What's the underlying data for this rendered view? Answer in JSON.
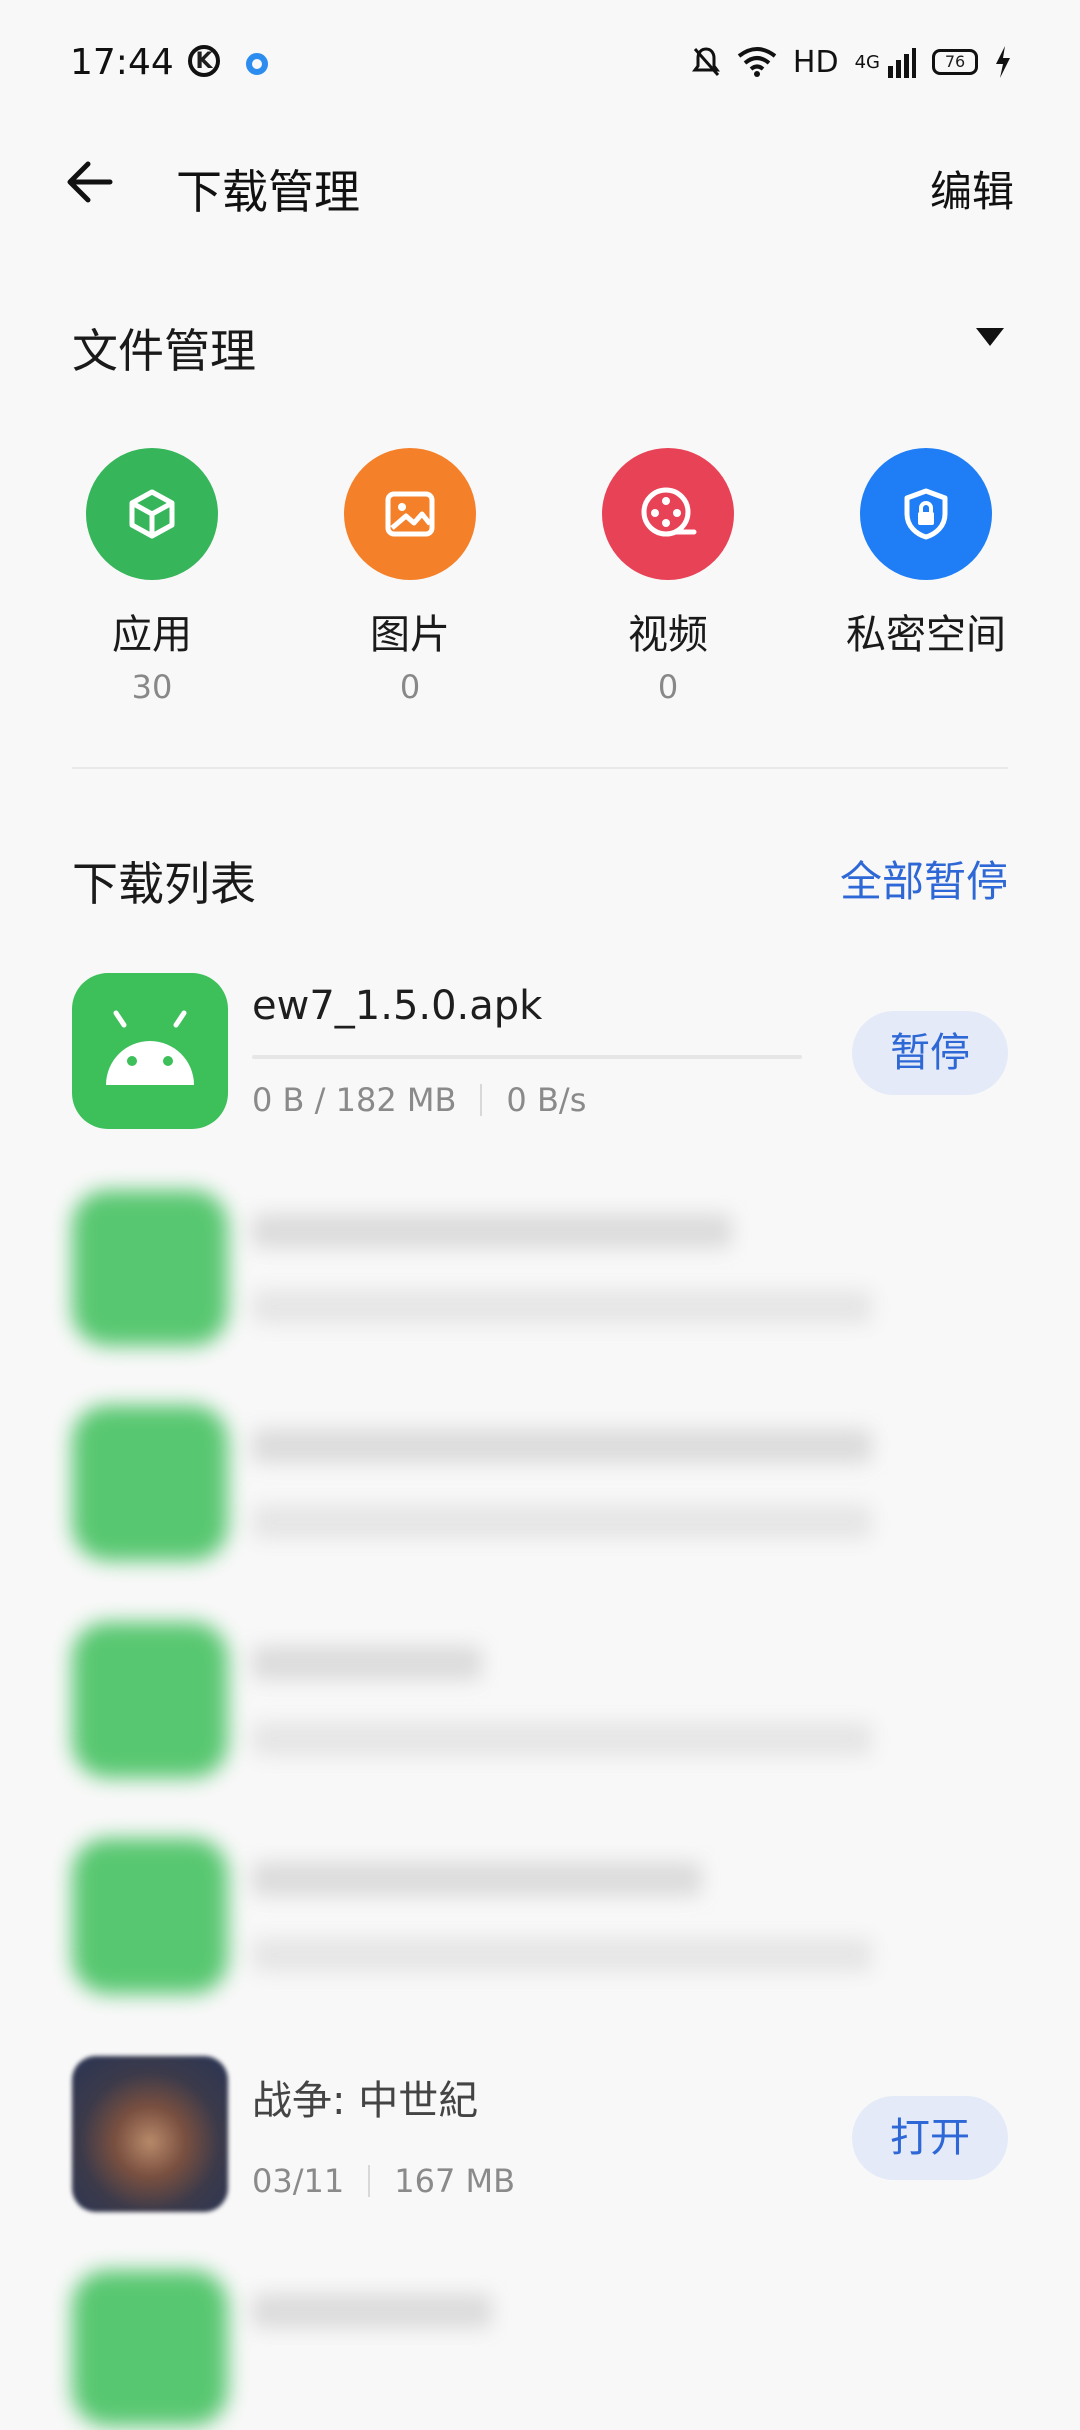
{
  "status_bar": {
    "time": "17:44",
    "k_icon_label": "K",
    "hd_label": "HD",
    "network_label": "4G",
    "battery_level": "76"
  },
  "header": {
    "title": "下载管理",
    "edit_label": "编辑"
  },
  "file_section": {
    "title": "文件管理",
    "categories": [
      {
        "label": "应用",
        "count": "30",
        "color": "#36b55a",
        "icon": "app-box-icon"
      },
      {
        "label": "图片",
        "count": "0",
        "color": "#f5802a",
        "icon": "image-icon"
      },
      {
        "label": "视频",
        "count": "0",
        "color": "#e84256",
        "icon": "video-reel-icon"
      },
      {
        "label": "私密空间",
        "count": "",
        "color": "#1f7ef5",
        "icon": "shield-lock-icon"
      }
    ]
  },
  "download_section": {
    "title": "下载列表",
    "pause_all_label": "全部暂停"
  },
  "downloads": [
    {
      "name": "ew7_1.5.0.apk",
      "size": "0 B / 182 MB",
      "speed": "0 B/s",
      "action": "暂停",
      "progress": 0
    },
    {
      "name": "",
      "blurred": true
    },
    {
      "name": "",
      "blurred": true
    },
    {
      "name": "",
      "blurred": true
    },
    {
      "name": "",
      "blurred": true
    },
    {
      "name": "战争: 中世紀",
      "date": "03/11",
      "size": "167 MB",
      "action": "打开"
    },
    {
      "name": "",
      "blurred": true
    }
  ],
  "colors": {
    "accent": "#2e67d6",
    "android_green": "#3dbf5a",
    "button_bg": "#e4eaf8"
  }
}
